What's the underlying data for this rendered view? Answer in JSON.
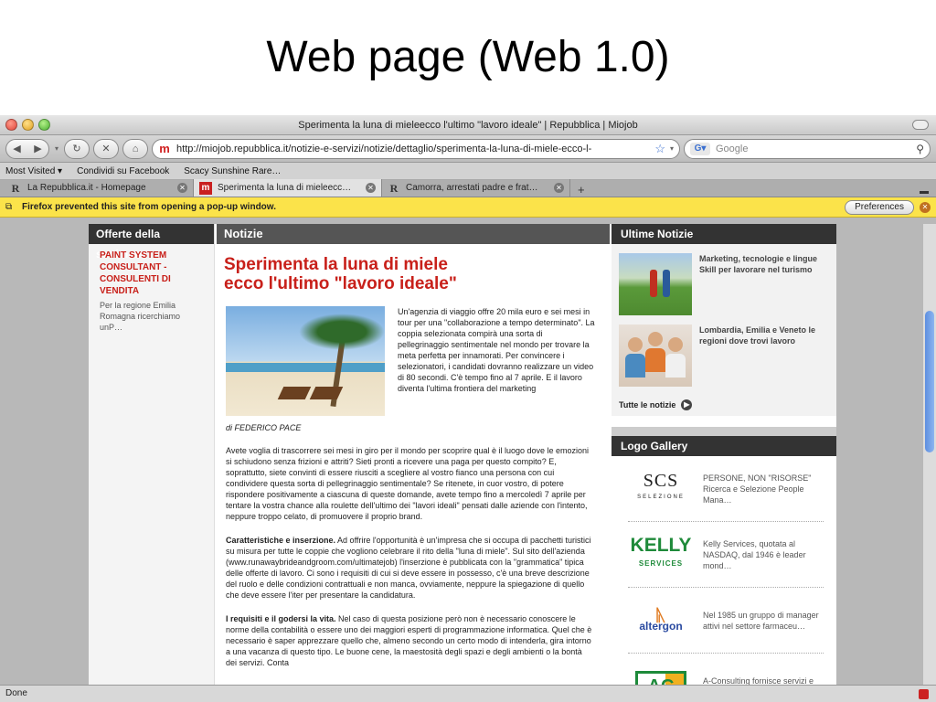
{
  "slide_title": "Web page (Web 1.0)",
  "window": {
    "title": "Sperimenta la luna di mieleecco l'ultimo \"lavoro ideale\" | Repubblica | Miojob"
  },
  "nav": {
    "url": "http://miojob.repubblica.it/notizie-e-servizi/notizie/dettaglio/sperimenta-la-luna-di-miele-ecco-l-",
    "search_placeholder": "Google"
  },
  "bookmarks": [
    "Most Visited ▾",
    "Condividi su Facebook",
    "Scacy Sunshine Rare…"
  ],
  "tabs": [
    {
      "label": "La Repubblica.it - Homepage",
      "icon": "R"
    },
    {
      "label": "Sperimenta la luna di mieleecc…",
      "icon": "m",
      "active": true
    },
    {
      "label": "Camorra, arrestati padre e frat…",
      "icon": "R"
    }
  ],
  "popup": {
    "message": "Firefox prevented this site from opening a pop-up window.",
    "button": "Preferences"
  },
  "status": "Done",
  "left": {
    "heading": "Offerte della settimana",
    "item_title": "PAINT SYSTEM CONSULTANT - CONSULENTI DI VENDITA",
    "item_text": "Per la regione Emilia Romagna ricerchiamo unP…"
  },
  "main": {
    "heading": "Notizie",
    "title_line1": "Sperimenta la luna di miele",
    "title_line2": "ecco l'ultimo \"lavoro ideale\"",
    "lead": "Un'agenzia di viaggio offre 20 mila euro e sei mesi in tour per una \"collaborazione a tempo determinato\". La coppia selezionata compirà una sorta di pellegrinaggio sentimentale nel mondo per trovare la meta perfetta per innamorati. Per convincere i selezionatori, i candidati dovranno realizzare un video di 80 secondi. C'è tempo fino al 7 aprile. E il lavoro diventa l'ultima frontiera del marketing",
    "byline": "di FEDERICO PACE",
    "p1": "Avete voglia di trascorrere sei mesi in giro per il mondo per scoprire qual è il luogo dove le emozioni si schiudono senza frizioni e attriti? Sieti pronti a ricevere una paga per questo compito? E, soprattutto, siete convinti di essere riusciti a scegliere al vostro fianco una persona con cui condividere questa sorta di pellegrinaggio sentimentale? Se ritenete, in cuor vostro, di potere rispondere positivamente a ciascuna di queste domande, avete tempo fino a mercoledì 7 aprile per tentare la vostra chance alla roulette dell'ultimo dei \"lavori ideali\" pensati dalle aziende con l'intento, neppure troppo celato, di promuovere il proprio brand.",
    "p2_bold": "Caratteristiche e inserzione.",
    "p2": " Ad offrire l'opportunità è un'impresa che si occupa di pacchetti turistici su misura per tutte le coppie che vogliono celebrare il rito della \"luna di miele\". Sul sito dell'azienda (www.runawaybrideandgroom.com/ultimatejob) l'inserzione è pubblicata con la \"grammatica\" tipica delle offerte di lavoro. Ci sono i requisiti di cui si deve essere in possesso, c'è una breve descrizione del ruolo e delle condizioni contrattuali e non manca, ovviamente, neppure la spiegazione di quello che deve essere l'iter per presentare la candidatura.",
    "p3_bold": "I requisiti e il godersi la vita.",
    "p3": " Nel caso di questa posizione però non è necessario conoscere le norme della contabilità o essere uno dei maggiori esperti di programmazione informatica. Quel che è necessario è saper apprezzare quello che, almeno secondo un certo modo di intenderla, gira intorno a una vacanza di questo tipo. Le buone cene, la maestosità degli spazi e degli ambienti o la bontà dei servizi. Conta"
  },
  "right": {
    "news_heading": "Ultime Notizie",
    "news": [
      "Marketing, tecnologie e lingue Skill per lavorare nel turismo",
      "Lombardia, Emilia e Veneto le regioni dove trovi lavoro"
    ],
    "all_news": "Tutte le notizie",
    "logo_heading": "Logo Gallery",
    "logos": [
      {
        "mark": "SCS",
        "sub": "SELEZIONE",
        "text": "PERSONE, NON \"RISORSE\" Ricerca e Selezione People Mana…"
      },
      {
        "mark": "KELLY",
        "sub": "SERVICES",
        "text": "Kelly Services, quotata al NASDAQ, dal 1946 è leader mond…"
      },
      {
        "mark": "altergon",
        "text": "Nel 1985 un gruppo di manager attivi nel settore farmaceu…"
      },
      {
        "mark": "AC",
        "text": "A-Consulting fornisce servizi e consulenza per la ricerca…"
      }
    ]
  }
}
